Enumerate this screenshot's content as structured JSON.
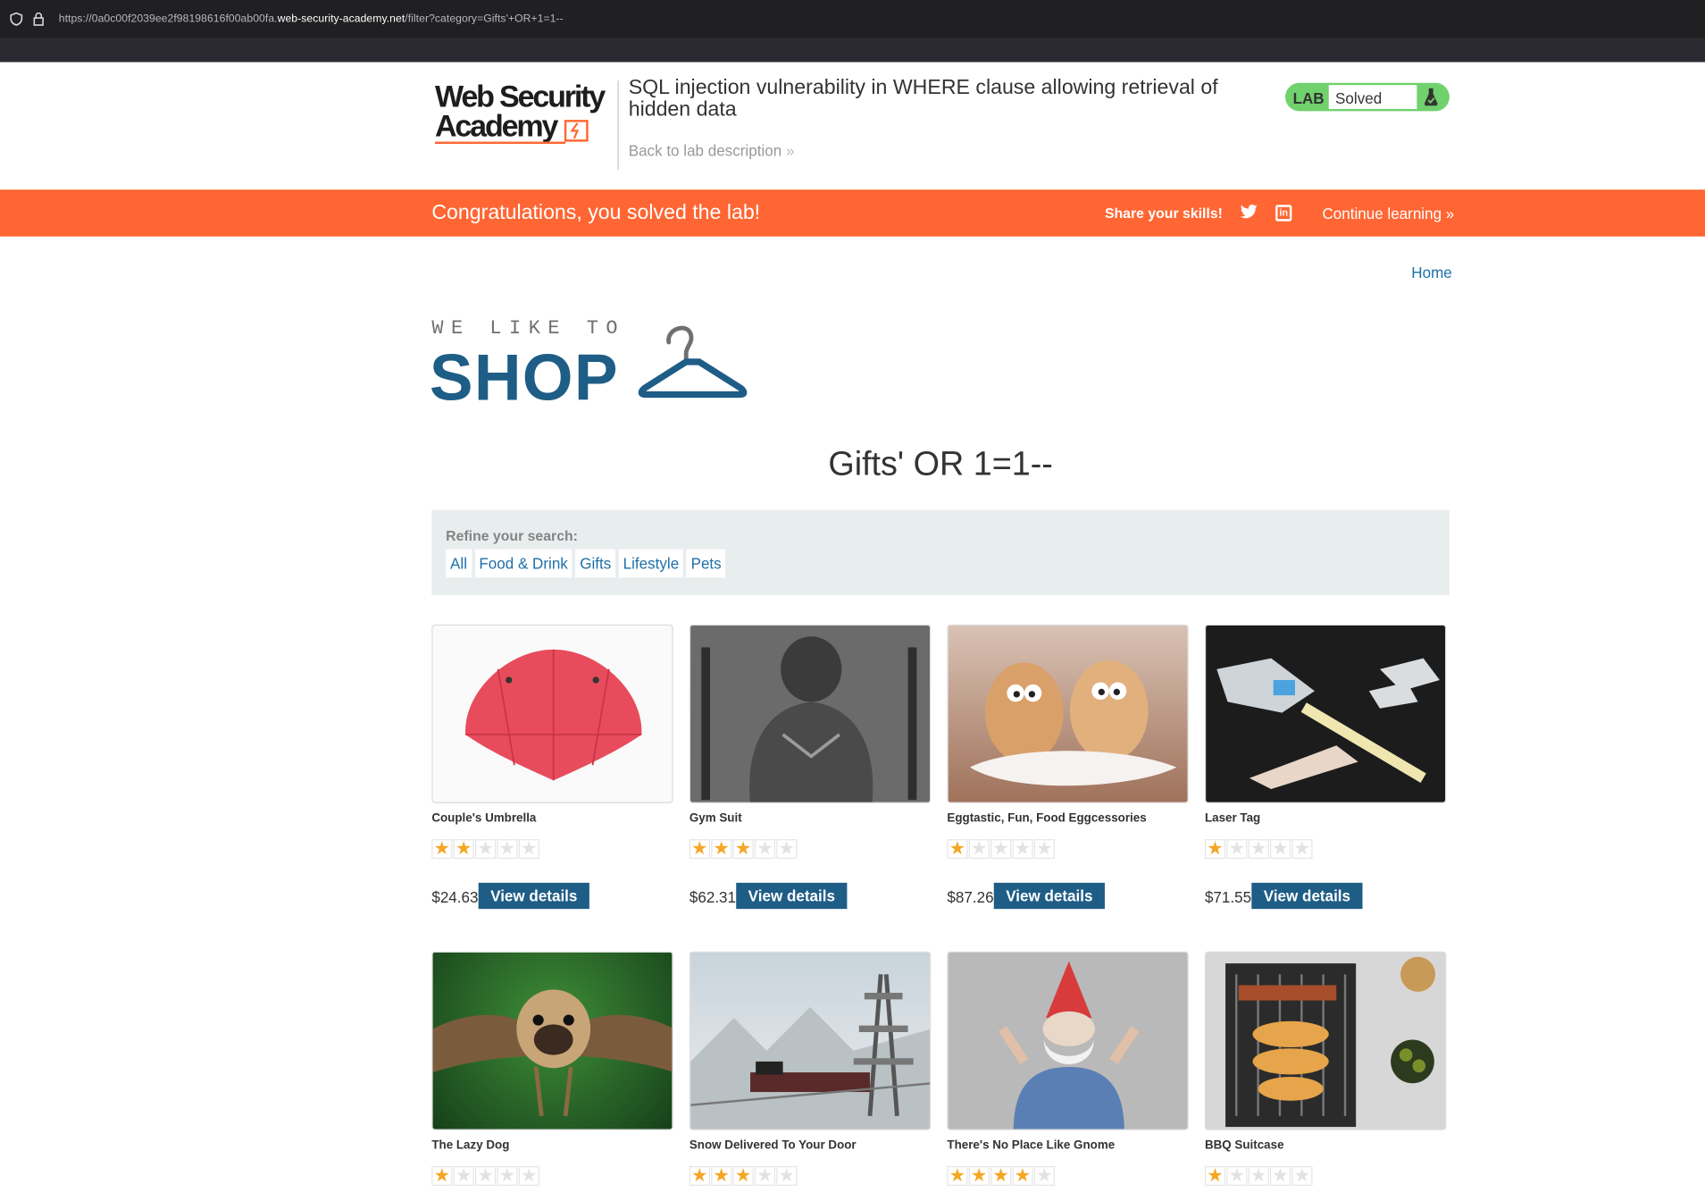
{
  "browser": {
    "url_prefix": "https://0a0c00f2039ee2f98198616f00ab00fa.",
    "url_host": "web-security-academy.net",
    "url_path": "/filter?category=Gifts'+OR+1=1--"
  },
  "lab": {
    "logo_line1": "Web Security",
    "logo_line2": "Academy",
    "title": "SQL injection vulnerability in WHERE clause allowing retrieval of hidden data",
    "back_link": "Back to lab description",
    "badge_label": "LAB",
    "badge_status": "Solved"
  },
  "banner": {
    "message": "Congratulations, you solved the lab!",
    "share": "Share your skills!",
    "continue": "Continue learning"
  },
  "nav": {
    "home": "Home"
  },
  "shop_logo": {
    "tagline": "WE LIKE TO",
    "word": "SHOP"
  },
  "category_title": "Gifts' OR 1=1--",
  "filters": {
    "label": "Refine your search:",
    "items": [
      "All",
      "Food & Drink",
      "Gifts",
      "Lifestyle",
      "Pets"
    ]
  },
  "colors": {
    "accent": "#ff6633",
    "brand": "#1e5d86",
    "link": "#1e6fa8",
    "solved": "#70d16d"
  },
  "products": [
    {
      "name": "Couple's Umbrella",
      "rating": 2,
      "price": "$24.63",
      "button": "View details"
    },
    {
      "name": "Gym Suit",
      "rating": 3,
      "price": "$62.31",
      "button": "View details"
    },
    {
      "name": "Eggtastic, Fun, Food Eggcessories",
      "rating": 1,
      "price": "$87.26",
      "button": "View details"
    },
    {
      "name": "Laser Tag",
      "rating": 1,
      "price": "$71.55",
      "button": "View details"
    },
    {
      "name": "The Lazy Dog",
      "rating": 1
    },
    {
      "name": "Snow Delivered To Your Door",
      "rating": 3
    },
    {
      "name": "There's No Place Like Gnome",
      "rating": 4
    },
    {
      "name": "BBQ Suitcase",
      "rating": 1
    }
  ]
}
